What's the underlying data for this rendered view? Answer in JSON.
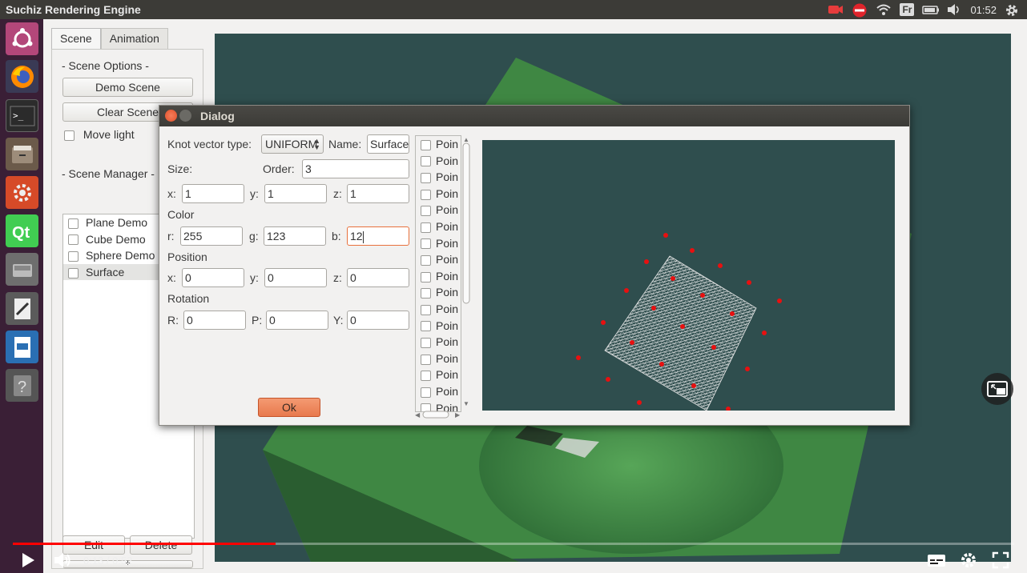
{
  "topbar": {
    "title": "Suchiz Rendering Engine",
    "keyboard_layout": "Fr",
    "clock": "01:52"
  },
  "main": {
    "tabs": [
      {
        "label": "Scene"
      },
      {
        "label": "Animation"
      }
    ],
    "scene_options_header": "- Scene Options -",
    "demo_scene_button": "Demo Scene",
    "clear_scene_button": "Clear Scene",
    "move_light_label": "Move light",
    "scene_manager_header": "- Scene Manager -",
    "scene_items": [
      {
        "label": "Plane Demo"
      },
      {
        "label": "Cube Demo"
      },
      {
        "label": "Sphere Demo"
      },
      {
        "label": "Surface"
      }
    ],
    "edit_button": "Edit",
    "delete_button": "Delete",
    "add_button": "+"
  },
  "dialog": {
    "title": "Dialog",
    "knot_vector_label": "Knot vector type:",
    "knot_vector_value": "UNIFORM",
    "name_label": "Name:",
    "name_value": "Surface",
    "size_label": "Size:",
    "order_label": "Order:",
    "order_value": "3",
    "size": {
      "x_label": "x:",
      "x": "1",
      "y_label": "y:",
      "y": "1",
      "z_label": "z:",
      "z": "1"
    },
    "color_label": "Color",
    "color": {
      "r_label": "r:",
      "r": "255",
      "g_label": "g:",
      "g": "123",
      "b_label": "b:",
      "b": "12"
    },
    "position_label": "Position",
    "position": {
      "x_label": "x:",
      "x": "0",
      "y_label": "y:",
      "y": "0",
      "z_label": "z:",
      "z": "0"
    },
    "rotation_label": "Rotation",
    "rotation": {
      "r_label": "R:",
      "r": "0",
      "p_label": "P:",
      "p": "0",
      "y_label": "Y:",
      "y": "0"
    },
    "ok_button": "Ok",
    "point_item_label": "Poin"
  },
  "video": {
    "time": "0:13 / 0:52",
    "progress_fraction": 0.262
  },
  "colors": {
    "accent_orange": "#e8794d",
    "viewport_bg": "#2f4e4e",
    "control_point": "#e81010",
    "progress": "#ff0000"
  }
}
